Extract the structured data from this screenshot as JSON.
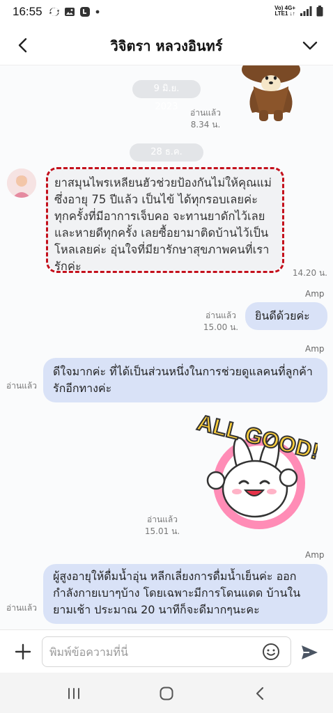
{
  "status_bar": {
    "time": "16:55",
    "net_line1": "Vo) 4G+",
    "net_line2": "LTE1 ↓↑",
    "icons": [
      "sync-icon",
      "gallery-icon",
      "line-app-icon",
      "dot-icon",
      "signal-icon",
      "battery-icon"
    ]
  },
  "header": {
    "title": "วิจิตรา หลวงอินทร์",
    "back_icon": "chevron-left-icon",
    "menu_icon": "chevron-down-icon"
  },
  "chat": {
    "date_1": "9 มิ.ย. 2023",
    "sticker_1_read": "อ่านแล้ว",
    "sticker_1_time": "8.34 น.",
    "date_2": "28 ธ.ค. 2023",
    "incoming_message": "ยาสมุนไพรเหลียนฮัวช่วยป้องกันไม่ให้คุณแม่ซึ่งอายุ 75 ปีแล้ว เป็นไข้ ได้ทุกรอบเลยค่ะ ทุกครั้งที่มีอาการเจ็บคอ จะทานยาดักไว้เลย และหายดีทุกครั้ง เลยซื้อยามาติดบ้านไว้เป็นโหลเลยค่ะ อุ่นใจที่มียารักษาสุขภาพคนที่เรารักค่ะ",
    "incoming_time": "14.20 น.",
    "reply_1_sender": "Amp",
    "reply_1_read": "อ่านแล้ว",
    "reply_1_time": "15.00 น.",
    "reply_1_text": "ยินดีด้วยค่ะ",
    "reply_2_sender": "Amp",
    "reply_2_read": "อ่านแล้ว",
    "reply_2_text": "ดีใจมากค่ะ ที่ได้เป็นส่วนหนึ่งในการช่วยดูแลคนที่ลูกค้ารักอีกทางค่ะ",
    "sticker_2_text": "ALL GOOD!",
    "sticker_2_read": "อ่านแล้ว",
    "sticker_2_time": "15.01 น.",
    "reply_3_sender": "Amp",
    "reply_3_read": "อ่านแล้ว",
    "reply_3_text": "ผู้สูงอายุให้ดื่มน้ำอุ่น หลีกเลี่ยงการดื่มน้ำเย็นค่ะ ออกกำลังกายเบาๆบ้าง โดยเฉพาะมีการโดนแดด บ้านในยามเช้า ประมาณ 20 นาทีก็จะดีมากๆนะคะ"
  },
  "input_bar": {
    "placeholder": "พิมพ์ข้อความที่นี่",
    "plus_icon": "plus-icon",
    "emoji_icon": "smiley-icon",
    "send_icon": "send-icon"
  },
  "nav_bar": {
    "icons": [
      "recent-apps-icon",
      "home-icon",
      "back-icon"
    ]
  },
  "colors": {
    "outgoing_bubble": "#d9e2f7",
    "incoming_bubble": "#f1f2f4",
    "highlight_border": "#c4101c",
    "date_chip": "#e3e5e8"
  }
}
